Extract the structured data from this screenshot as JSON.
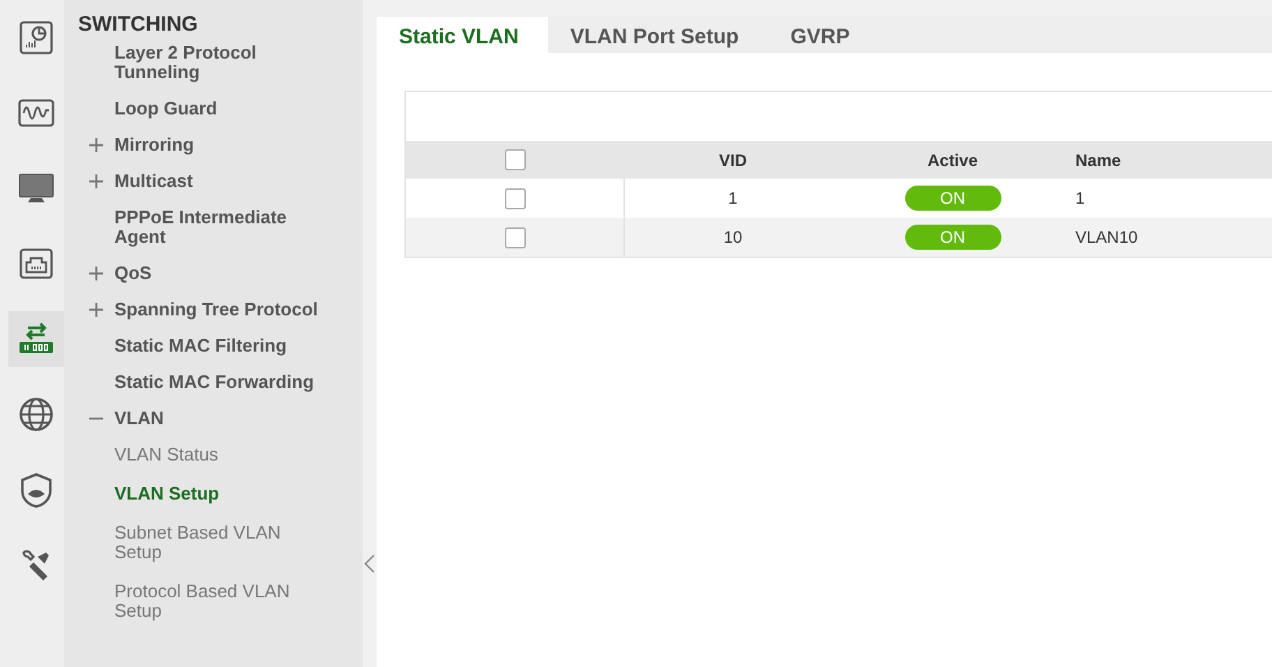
{
  "rail": [
    {
      "kind": "dashboard",
      "selected": false
    },
    {
      "kind": "wave",
      "selected": false
    },
    {
      "kind": "monitor",
      "selected": false
    },
    {
      "kind": "port",
      "selected": false
    },
    {
      "kind": "switch",
      "selected": true
    },
    {
      "kind": "globe",
      "selected": false
    },
    {
      "kind": "shield",
      "selected": false
    },
    {
      "kind": "tools",
      "selected": false
    }
  ],
  "menu": {
    "title": "SWITCHING",
    "items": [
      {
        "label": "Layer 2 Protocol Tunneling",
        "selected": false
      },
      {
        "label": "Loop Guard",
        "selected": false
      },
      {
        "label": "Mirroring",
        "expanded": false,
        "selected": false
      },
      {
        "label": "Multicast",
        "expanded": false,
        "selected": false
      },
      {
        "label": "PPPoE Intermediate Agent",
        "selected": false
      },
      {
        "label": "QoS",
        "expanded": false,
        "selected": false
      },
      {
        "label": "Spanning Tree Protocol",
        "expanded": false,
        "selected": false
      },
      {
        "label": "Static MAC Filtering",
        "selected": false
      },
      {
        "label": "Static MAC Forwarding",
        "selected": false
      },
      {
        "label": "VLAN",
        "expanded": true,
        "selected": false,
        "children": [
          {
            "label": "VLAN Status",
            "selected": false
          },
          {
            "label": "VLAN Setup",
            "selected": true
          },
          {
            "label": "Subnet Based VLAN Setup",
            "selected": false
          },
          {
            "label": "Protocol Based VLAN Setup",
            "selected": false
          }
        ]
      }
    ]
  },
  "tabs": [
    {
      "label": "Static VLAN",
      "selected": true
    },
    {
      "label": "VLAN Port Setup",
      "selected": false
    },
    {
      "label": "GVRP",
      "selected": false
    }
  ],
  "table": {
    "columns": [
      "VID",
      "Active",
      "Name"
    ],
    "select_all_checked": false,
    "rows": [
      {
        "checked": false,
        "vid": "1",
        "active": {
          "label": "ON",
          "on": true
        },
        "name": "1"
      },
      {
        "checked": false,
        "vid": "10",
        "active": {
          "label": "ON",
          "on": true
        },
        "name": "VLAN10"
      }
    ]
  }
}
